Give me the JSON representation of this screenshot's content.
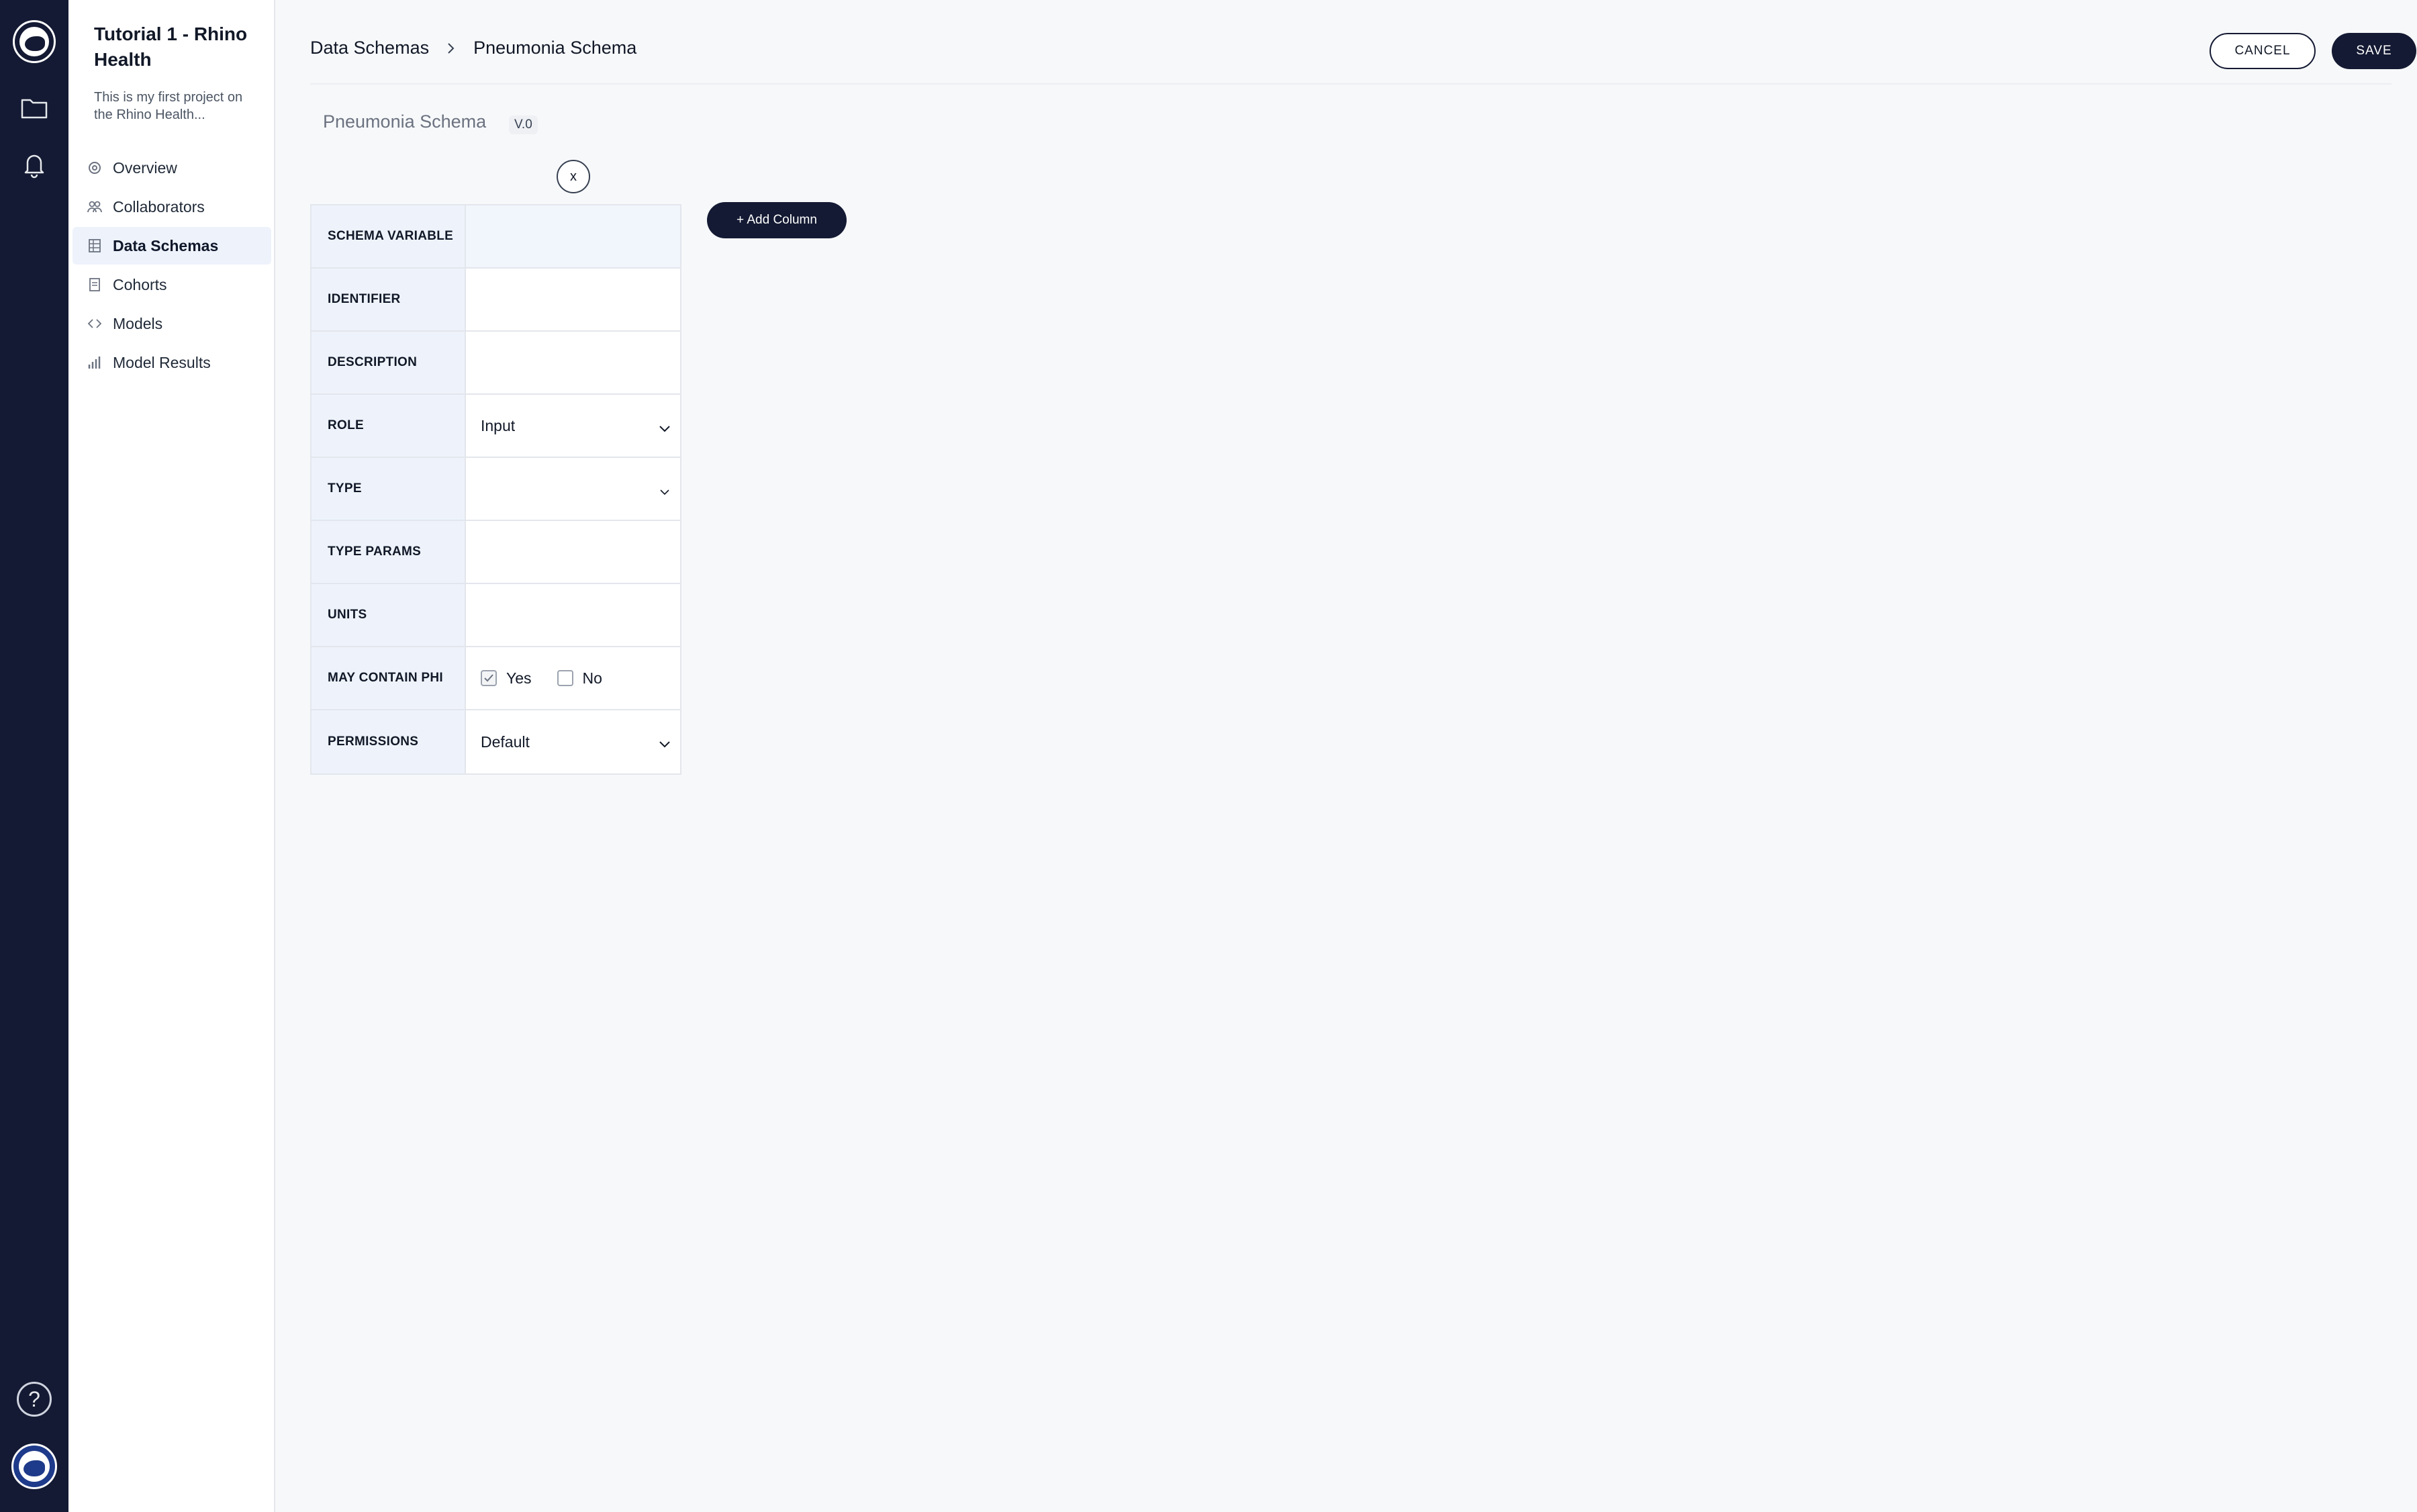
{
  "rail": {
    "icons": [
      "rhino-logo-icon",
      "folder-icon",
      "bell-icon",
      "help-icon",
      "user-avatar-icon"
    ],
    "help_label": "?"
  },
  "sidebar": {
    "project_title": "Tutorial 1 - Rhino Health",
    "project_description": "This is my first project on the Rhino Health...",
    "items": [
      {
        "label": "Overview",
        "icon": "overview-icon",
        "active": false
      },
      {
        "label": "Collaborators",
        "icon": "people-icon",
        "active": false
      },
      {
        "label": "Data Schemas",
        "icon": "table-icon",
        "active": true
      },
      {
        "label": "Cohorts",
        "icon": "document-icon",
        "active": false
      },
      {
        "label": "Models",
        "icon": "code-icon",
        "active": false
      },
      {
        "label": "Model Results",
        "icon": "bar-chart-icon",
        "active": false
      }
    ]
  },
  "header": {
    "breadcrumb_parent": "Data Schemas",
    "breadcrumb_current": "Pneumonia Schema",
    "cancel_label": "CANCEL",
    "save_label": "SAVE"
  },
  "schema": {
    "name": "Pneumonia Schema",
    "version": "V.0",
    "remove_column_label": "x",
    "add_column_label": "+ Add Column",
    "fields": {
      "schema_variable": {
        "label": "SCHEMA VARIABLE",
        "value": ""
      },
      "identifier": {
        "label": "IDENTIFIER",
        "value": ""
      },
      "description": {
        "label": "DESCRIPTION",
        "value": ""
      },
      "role": {
        "label": "ROLE",
        "value": "Input"
      },
      "type": {
        "label": "TYPE",
        "value": ""
      },
      "type_params": {
        "label": "TYPE PARAMS",
        "value": ""
      },
      "units": {
        "label": "UNITS",
        "value": ""
      },
      "may_contain_phi": {
        "label": "MAY CONTAIN PHI",
        "yes_label": "Yes",
        "no_label": "No",
        "yes_checked": true,
        "no_checked": false
      },
      "permissions": {
        "label": "PERMISSIONS",
        "value": "Default"
      }
    }
  },
  "colors": {
    "navy": "#141a33",
    "label_bg": "#eef3fb",
    "page_bg": "#f7f8fa"
  }
}
